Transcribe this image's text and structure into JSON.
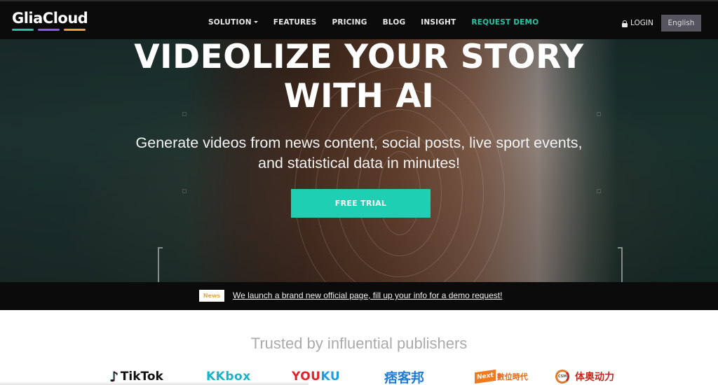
{
  "nav": {
    "logo": "GliaCloud",
    "logo_bar_colors": [
      "#23c4a5",
      "#8a5cf5",
      "#f0a23a"
    ],
    "menu": [
      {
        "label": "SOLUTION",
        "has_dropdown": true
      },
      {
        "label": "FEATURES"
      },
      {
        "label": "PRICING"
      },
      {
        "label": "BLOG"
      },
      {
        "label": "INSIGHT"
      },
      {
        "label": "REQUEST DEMO",
        "accent": true
      }
    ],
    "login_label": "LOGIN",
    "language": "English",
    "accent_color": "#23c4a5"
  },
  "hero": {
    "title_line1": "VIDEOLIZE YOUR STORY",
    "title_line2": "WITH AI",
    "subtitle_line1": "Generate videos from news content, social posts, live sport events,",
    "subtitle_line2": "and statistical data in minutes!",
    "cta_label": "FREE TRIAL",
    "cta_color": "#1fcfb3"
  },
  "news": {
    "badge": "News",
    "link_text": "We launch a brand new official page, fill up your info for a demo request!"
  },
  "publishers": {
    "heading": "Trusted by influential publishers",
    "logos": {
      "tiktok": "TikTok",
      "kkbox": "KKbox",
      "youku_1": "YOU",
      "youku_2": "KU",
      "pixnet": "痞客邦",
      "nexttv_badge": "Next",
      "nexttv": "數位時代",
      "csm_badge": "CSM",
      "csm": "体奥动力"
    }
  }
}
